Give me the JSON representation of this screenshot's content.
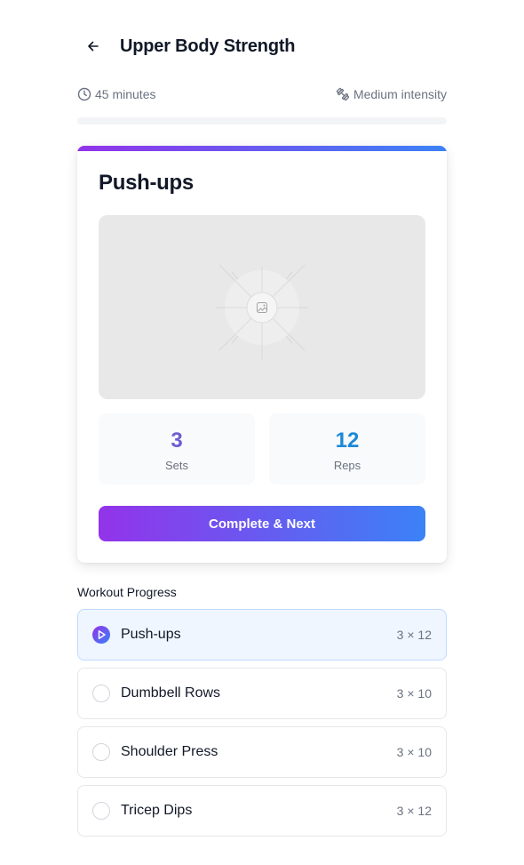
{
  "header": {
    "title": "Upper Body Strength",
    "back_icon": "arrow-left-icon"
  },
  "meta": {
    "duration": "45 minutes",
    "duration_icon": "clock-icon",
    "intensity": "Medium intensity",
    "intensity_icon": "dumbbell-icon"
  },
  "progress": {
    "fraction": 0.0
  },
  "current_exercise": {
    "name": "Push-ups",
    "image_icon": "image-placeholder-icon",
    "sets_value": "3",
    "sets_label": "Sets",
    "reps_value": "12",
    "reps_label": "Reps",
    "action_label": "Complete & Next"
  },
  "workout_progress": {
    "title": "Workout Progress",
    "items": [
      {
        "name": "Push-ups",
        "meta": "3 × 12",
        "status": "current",
        "icon": "play-icon"
      },
      {
        "name": "Dumbbell Rows",
        "meta": "3 × 10",
        "status": "pending",
        "icon": "empty-circle-icon"
      },
      {
        "name": "Shoulder Press",
        "meta": "3 × 10",
        "status": "pending",
        "icon": "empty-circle-icon"
      },
      {
        "name": "Tricep Dips",
        "meta": "3 × 12",
        "status": "pending",
        "icon": "empty-circle-icon"
      }
    ]
  },
  "colors": {
    "gradient_start": "#9333ea",
    "gradient_end": "#3b82f6",
    "sets_color": "#6d5bd0",
    "reps_color": "#1e88d8"
  }
}
